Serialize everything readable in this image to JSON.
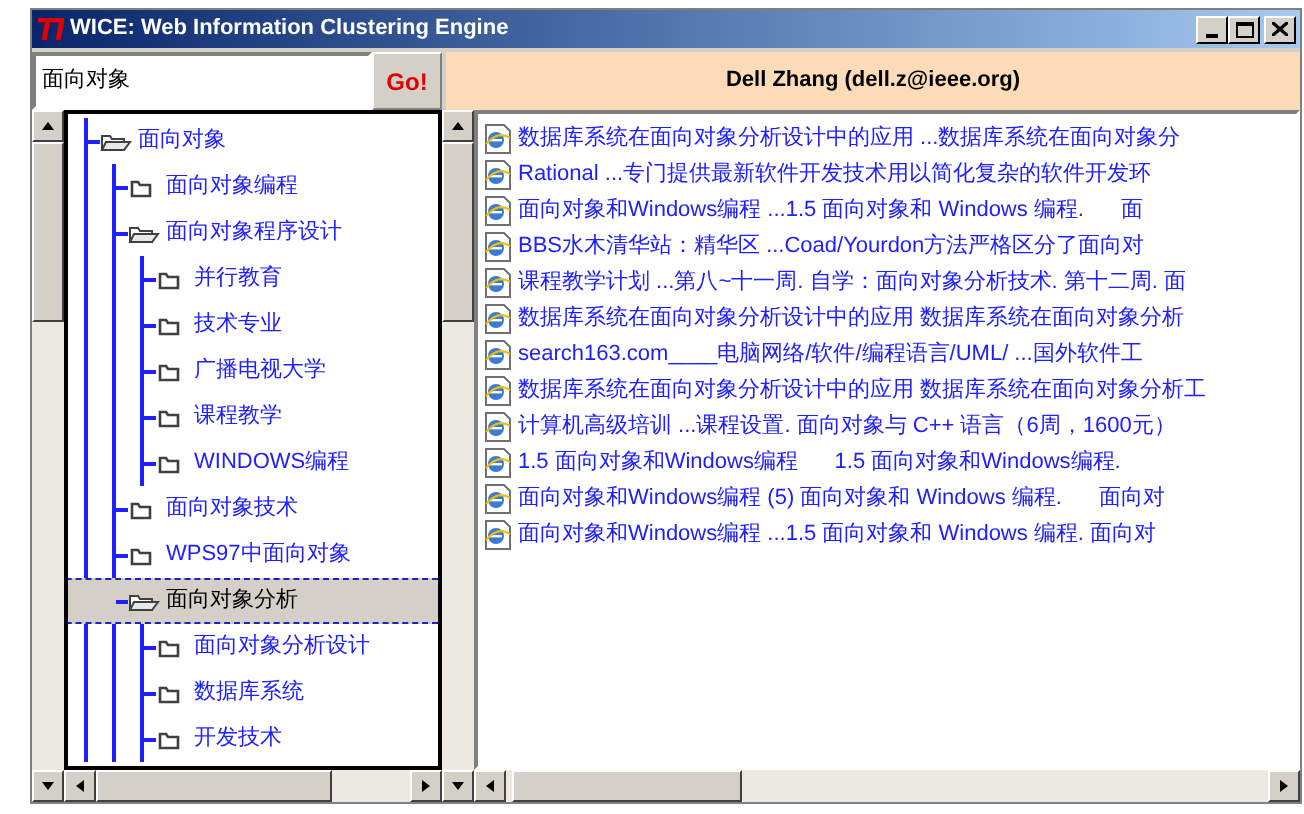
{
  "window": {
    "title": "WICE: Web Information Clustering Engine"
  },
  "search": {
    "value": "面向对象",
    "button": "Go!"
  },
  "header": "Dell Zhang (dell.z@ieee.org)",
  "tree": [
    {
      "label": "面向对象",
      "expanded": true,
      "selected": false,
      "children": [
        {
          "label": "面向对象编程",
          "expanded": false,
          "selected": false
        },
        {
          "label": "面向对象程序设计",
          "expanded": true,
          "selected": false,
          "children": [
            {
              "label": "并行教育",
              "expanded": false,
              "selected": false
            },
            {
              "label": "技术专业",
              "expanded": false,
              "selected": false
            },
            {
              "label": "广播电视大学",
              "expanded": false,
              "selected": false
            },
            {
              "label": "课程教学",
              "expanded": false,
              "selected": false
            },
            {
              "label": "WINDOWS编程",
              "expanded": false,
              "selected": false
            }
          ]
        },
        {
          "label": "面向对象技术",
          "expanded": false,
          "selected": false
        },
        {
          "label": "WPS97中面向对象",
          "expanded": false,
          "selected": false
        },
        {
          "label": "面向对象分析",
          "expanded": true,
          "selected": true,
          "children": [
            {
              "label": "面向对象分析设计",
              "expanded": false,
              "selected": false
            },
            {
              "label": "数据库系统",
              "expanded": false,
              "selected": false
            },
            {
              "label": "开发技术",
              "expanded": false,
              "selected": false
            }
          ]
        }
      ]
    }
  ],
  "results": [
    {
      "text": "数据库系统在面向对象分析设计中的应用 ...数据库系统在面向对象分"
    },
    {
      "text": "Rational ...专门提供最新软件开发技术用以简化复杂的软件开发环"
    },
    {
      "text": "面向对象和Windows编程 ...1.5 面向对象和 Windows 编程.      面"
    },
    {
      "text": "BBS水木清华站：精华区 ...Coad/Yourdon方法严格区分了面向对"
    },
    {
      "text": "课程教学计划 ...第八~十一周. 自学：面向对象分析技术. 第十二周. 面"
    },
    {
      "text": "数据库系统在面向对象分析设计中的应用 数据库系统在面向对象分析"
    },
    {
      "text": "search163.com____电脑网络/软件/编程语言/UML/ ...国外软件工"
    },
    {
      "text": "数据库系统在面向对象分析设计中的应用 数据库系统在面向对象分析工"
    },
    {
      "text": "计算机高级培训 ...课程设置. 面向对象与 C++ 语言（6周，1600元）"
    },
    {
      "text": "1.5 面向对象和Windows编程      1.5 面向对象和Windows编程."
    },
    {
      "text": "面向对象和Windows编程 (5) 面向对象和 Windows 编程.      面向对"
    },
    {
      "text": "面向对象和Windows编程 ...1.5 面向对象和 Windows 编程. 面向对"
    }
  ]
}
